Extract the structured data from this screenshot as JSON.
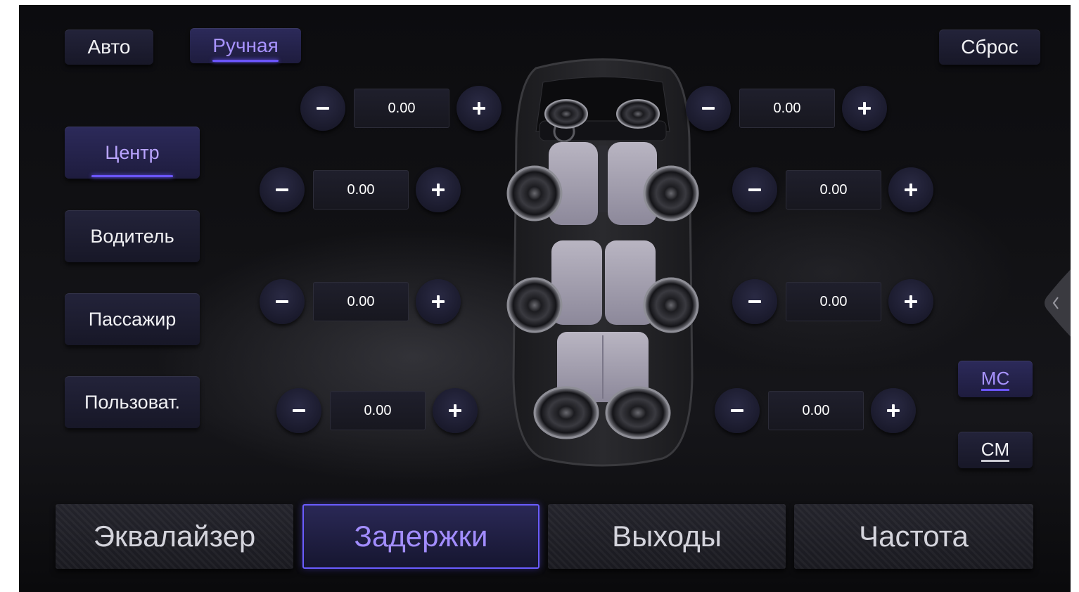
{
  "mode": {
    "auto_label": "Авто",
    "manual_label": "Ручная",
    "active": "manual"
  },
  "reset_label": "Сброс",
  "listening_positions": [
    {
      "label": "Центр",
      "active": true
    },
    {
      "label": "Водитель",
      "active": false
    },
    {
      "label": "Пассажир",
      "active": false
    },
    {
      "label": "Пользоват.",
      "active": false
    }
  ],
  "delay_controls": {
    "left": [
      "0.00",
      "0.00",
      "0.00",
      "0.00"
    ],
    "right": [
      "0.00",
      "0.00",
      "0.00",
      "0.00"
    ]
  },
  "units": {
    "ms_label": "MC",
    "cm_label": "CM",
    "active": "ms"
  },
  "tabs": [
    {
      "label": "Эквалайзер",
      "active": false
    },
    {
      "label": "Задержки",
      "active": true
    },
    {
      "label": "Выходы",
      "active": false
    },
    {
      "label": "Частота",
      "active": false
    }
  ],
  "icons": {
    "decrease": "minus-icon",
    "increase": "plus-icon",
    "side_panel": "chevron-left-icon"
  },
  "colors": {
    "accent": "#6b55ff",
    "active_text": "#a893ff",
    "background": "#111114"
  }
}
